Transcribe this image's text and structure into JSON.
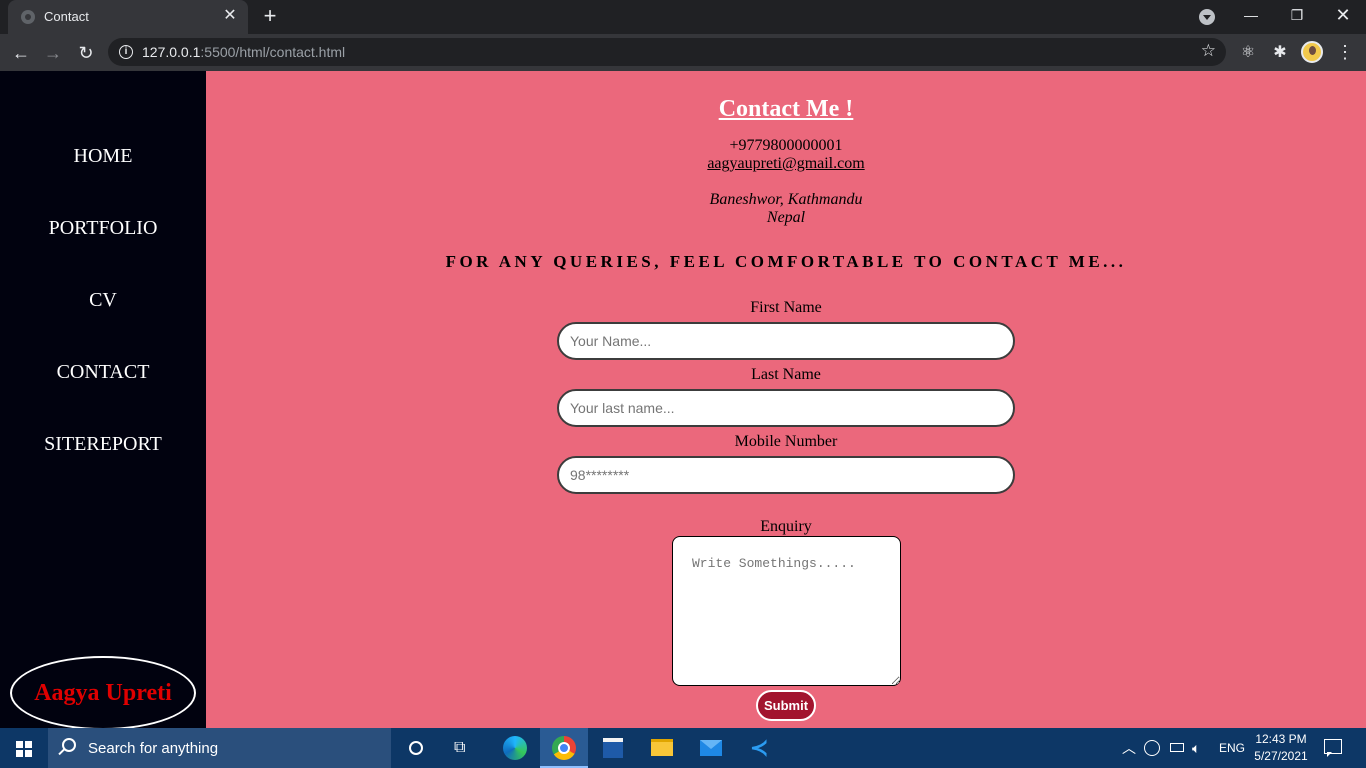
{
  "browser": {
    "tab_title": "Contact",
    "tab_close": "✕",
    "new_tab": "+",
    "url_host": "127.0.0.1",
    "url_rest": ":5500/html/contact.html",
    "window_min": "—",
    "window_max": "❐",
    "window_close": "✕"
  },
  "sidebar": {
    "nav": [
      {
        "label": "HOME"
      },
      {
        "label": "PORTFOLIO"
      },
      {
        "label": "CV"
      },
      {
        "label": "CONTACT"
      },
      {
        "label": "SITEREPORT"
      }
    ],
    "brand": "Aagya Upreti"
  },
  "content": {
    "title": "Contact Me !",
    "phone": "+9779800000001",
    "email": "aagyaupreti@gmail.com",
    "address_line1": "Baneshwor, Kathmandu",
    "address_line2": "Nepal",
    "tagline": "FOR ANY QUERIES, FEEL COMFORTABLE TO CONTACT ME..."
  },
  "form": {
    "first_name_label": "First Name",
    "first_name_placeholder": "Your Name...",
    "last_name_label": "Last Name",
    "last_name_placeholder": "Your last name...",
    "mobile_label": "Mobile Number",
    "mobile_placeholder": "98********",
    "enquiry_label": "Enquiry",
    "enquiry_placeholder": "Write Somethings.....",
    "submit_label": "Submit"
  },
  "taskbar": {
    "search_placeholder": "Search for anything",
    "language": "ENG",
    "time": "12:43 PM",
    "date": "5/27/2021"
  },
  "colors": {
    "page_background": "#eb687c",
    "sidebar_background": "#01020f",
    "brand_text": "#e00000",
    "submit_background": "#a2142e"
  }
}
